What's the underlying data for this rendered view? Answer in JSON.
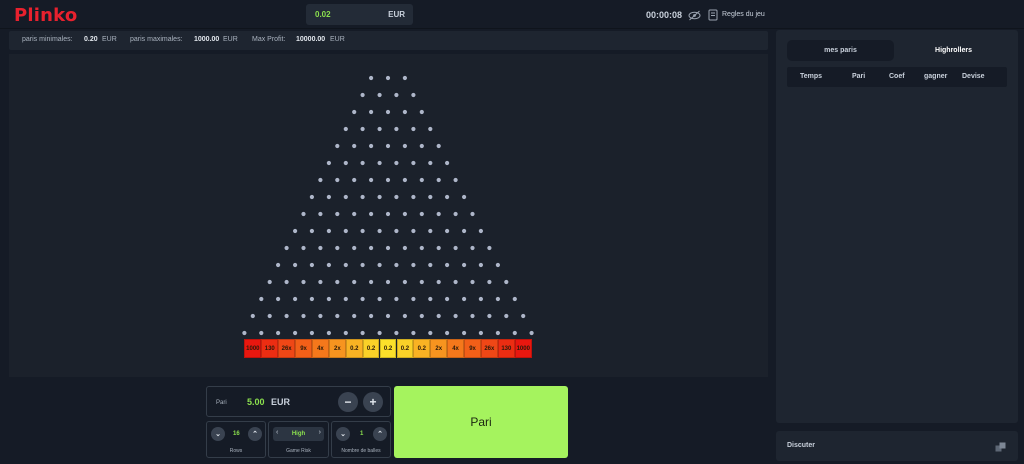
{
  "header": {
    "logo": "Plinko",
    "balance": {
      "amount": "0.02",
      "currency": "EUR"
    },
    "timer": "00:00:08",
    "rules_label": "Regles du jeu"
  },
  "limits": {
    "min_label": "paris minimales:",
    "min_value": "0.20",
    "min_currency": "EUR",
    "max_label": "paris maximales:",
    "max_value": "1000.00",
    "max_currency": "EUR",
    "profit_label": "Max Profit:",
    "profit_value": "10000.00",
    "profit_currency": "EUR"
  },
  "board": {
    "rows": 16,
    "multipliers": [
      "1000",
      "130",
      "26x",
      "9x",
      "4x",
      "2x",
      "0.2",
      "0.2",
      "0.2",
      "0.2",
      "0.2",
      "2x",
      "4x",
      "9x",
      "26x",
      "130",
      "1000"
    ],
    "colors": [
      "#e8170f",
      "#ec2d12",
      "#ef4716",
      "#f25f18",
      "#f5781b",
      "#f7941f",
      "#f9b223",
      "#fad128",
      "#fbe02a",
      "#fad128",
      "#f9b223",
      "#f7941f",
      "#f5781b",
      "#f25f18",
      "#ef4716",
      "#ec2d12",
      "#e8170f"
    ],
    "peg_color": "#aeb6c9"
  },
  "right_panel": {
    "tabs": [
      "mes paris",
      "Highrollers"
    ],
    "active_tab": "Highrollers",
    "columns": [
      "Temps",
      "Pari",
      "Coef",
      "gagner",
      "Devise"
    ]
  },
  "chat": {
    "label": "Discuter"
  },
  "bet": {
    "label": "Pari",
    "amount": "5.00",
    "currency": "EUR",
    "minus": "−",
    "plus": "+",
    "button_label": "Pari"
  },
  "controls": {
    "rows": {
      "value": "16",
      "caption": "Rows"
    },
    "risk": {
      "value": "High",
      "caption": "Game Risk"
    },
    "balls": {
      "value": "1",
      "caption": "Nombre de balles"
    }
  },
  "colors": {
    "accent_green": "#8be04e",
    "bet_button": "#a5f35e",
    "brand_red": "#e8212e"
  }
}
